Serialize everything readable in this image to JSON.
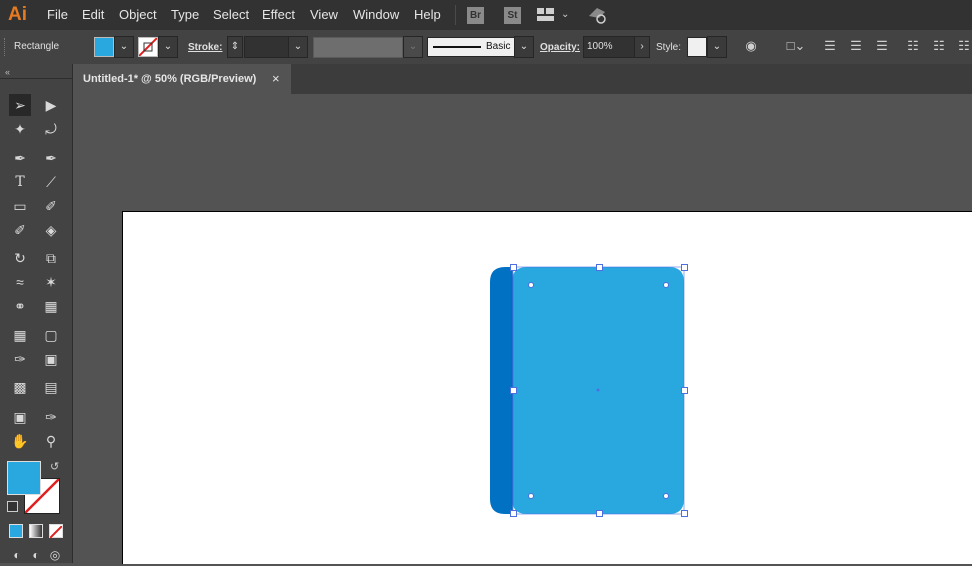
{
  "app": {
    "logo": "Ai"
  },
  "menu": [
    "File",
    "Edit",
    "Object",
    "Type",
    "Select",
    "Effect",
    "View",
    "Window",
    "Help"
  ],
  "menu_badges": {
    "bridge": "Br",
    "stock": "St"
  },
  "control": {
    "object_type": "Rectangle",
    "stroke_label": "Stroke:",
    "brush_label": "Basic",
    "opacity_label": "Opacity:",
    "opacity_value": "100%",
    "style_label": "Style:"
  },
  "tab": {
    "title": "Untitled-1* @ 50% (RGB/Preview)",
    "close": "×"
  },
  "colors": {
    "fill": "#29a8e0",
    "shape_back": "#0071c3",
    "shape_front": "#29a8e0",
    "selection": "#4d6fe0"
  }
}
